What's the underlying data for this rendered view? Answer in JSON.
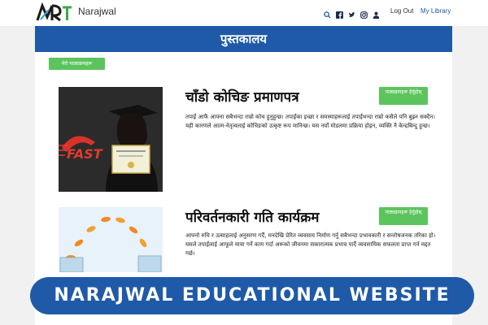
{
  "header": {
    "brand": "Narajwal",
    "nav": {
      "logout": "Log Out",
      "library": "My Library"
    },
    "icons": [
      "search-icon",
      "facebook-icon",
      "twitter-icon",
      "instagram-icon",
      "user-icon"
    ]
  },
  "banner": {
    "title": "पुस्तकालय"
  },
  "my_courses_button": "मेरो पाठ्यक्रमहरू",
  "courses": [
    {
      "title": "चाँडो कोचिङ प्रमाणपत्र",
      "button": "पाठ्यक्रमहरू हेर्नुहोस्",
      "desc": "तपाईं आफैं आफ्ना सबैभन्दा राम्रो कोच हुनुहुन्छ। तपाईंका इच्छा र समस्याहरूलाई तपाईंभन्दा राम्रो कसैले पनि बुझ्न सक्दैन। यही कारणले आत्म-नेतृत्वलाई कोचिङको उत्कृष्ट रूप मानिन्छ। यस नयाँ मोडलमा प्रक्रिया होइन, व्यक्ति नै केन्द्रबिन्दु हुन्छ।"
    },
    {
      "title": "परिवर्तनकारी गति कार्यक्रम",
      "button": "पाठ्यक्रमहरू हेर्नुहोस्",
      "desc": "आफ्नो रुचि र उत्साहलाई अनुसरण गर्दै, मनदेखि प्रेरित व्यवसाय निर्माण गर्नु सबैभन्दा प्रभावकारी र सन्तोषजनक तरिका हो। यसले तपाईंलाई आफूले माया गर्ने काम गर्दा अरूको जीवनमा सकारात्मक प्रभाव पार्दै व्यवसायिक सफलता प्राप्त गर्न मद्दत गर्छ।"
    }
  ],
  "bottom_banner": "NARAJWAL EDUCATIONAL WEBSITE",
  "colors": {
    "primary": "#1f5aa8",
    "green": "#5cc45c"
  }
}
